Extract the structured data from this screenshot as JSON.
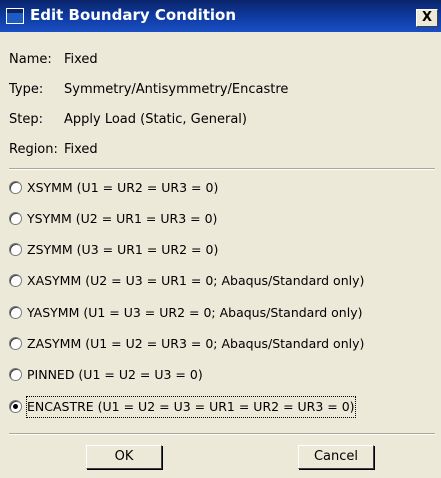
{
  "window": {
    "title": "Edit Boundary Condition",
    "close_label": "X"
  },
  "info": [
    {
      "label": "Name:",
      "value": "Fixed"
    },
    {
      "label": "Type:",
      "value": "Symmetry/Antisymmetry/Encastre"
    },
    {
      "label": "Step:",
      "value": "Apply Load (Static, General)"
    },
    {
      "label": "Region:",
      "value": "Fixed"
    }
  ],
  "options": [
    {
      "label": "XSYMM (U1 = UR2 = UR3 = 0)",
      "selected": false
    },
    {
      "label": "YSYMM (U2 = UR1 = UR3 = 0)",
      "selected": false
    },
    {
      "label": "ZSYMM (U3 = UR1 = UR2 = 0)",
      "selected": false
    },
    {
      "label": "XASYMM (U2 = U3 = UR1 = 0; Abaqus/Standard only)",
      "selected": false
    },
    {
      "label": "YASYMM (U1 = U3 = UR2 = 0; Abaqus/Standard only)",
      "selected": false
    },
    {
      "label": "ZASYMM (U1 = U2 = UR3 = 0; Abaqus/Standard only)",
      "selected": false
    },
    {
      "label": "PINNED (U1 = U2 = U3 = 0)",
      "selected": false
    },
    {
      "label": "ENCASTRE (U1 = U2 = U3 = UR1 = UR2 = UR3 = 0)",
      "selected": true
    }
  ],
  "buttons": {
    "ok_label": "OK",
    "cancel_label": "Cancel"
  }
}
